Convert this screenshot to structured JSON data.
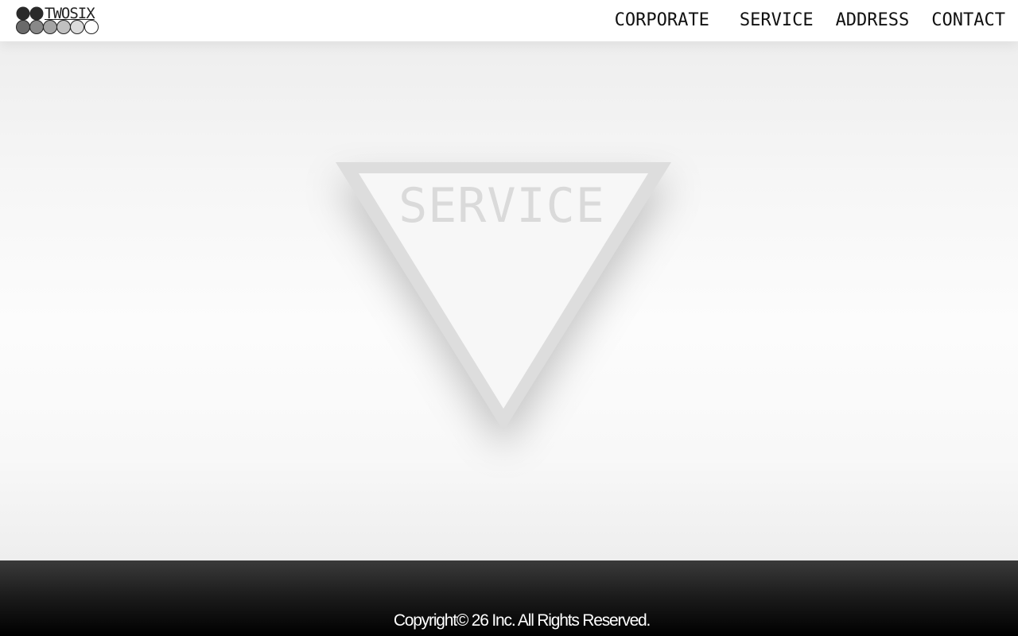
{
  "brand": {
    "name": "TWOSIX",
    "logo_dot_count_top": 2,
    "logo_dot_count_bottom": 6
  },
  "nav": {
    "items": [
      {
        "label": "CORPORATE"
      },
      {
        "label": "SERVICE"
      },
      {
        "label": "ADDRESS"
      },
      {
        "label": "CONTACT"
      }
    ]
  },
  "hero": {
    "title": "SERVICE",
    "shape": "down-triangle",
    "frame_color": "#dddddd",
    "fill_color": "#f7f7f7"
  },
  "footer": {
    "copyright": "Copyright© 26 Inc. All Rights Reserved."
  },
  "colors": {
    "header_bg": "#ffffff",
    "footer_bg": "#000000",
    "text_dark": "#111111"
  }
}
